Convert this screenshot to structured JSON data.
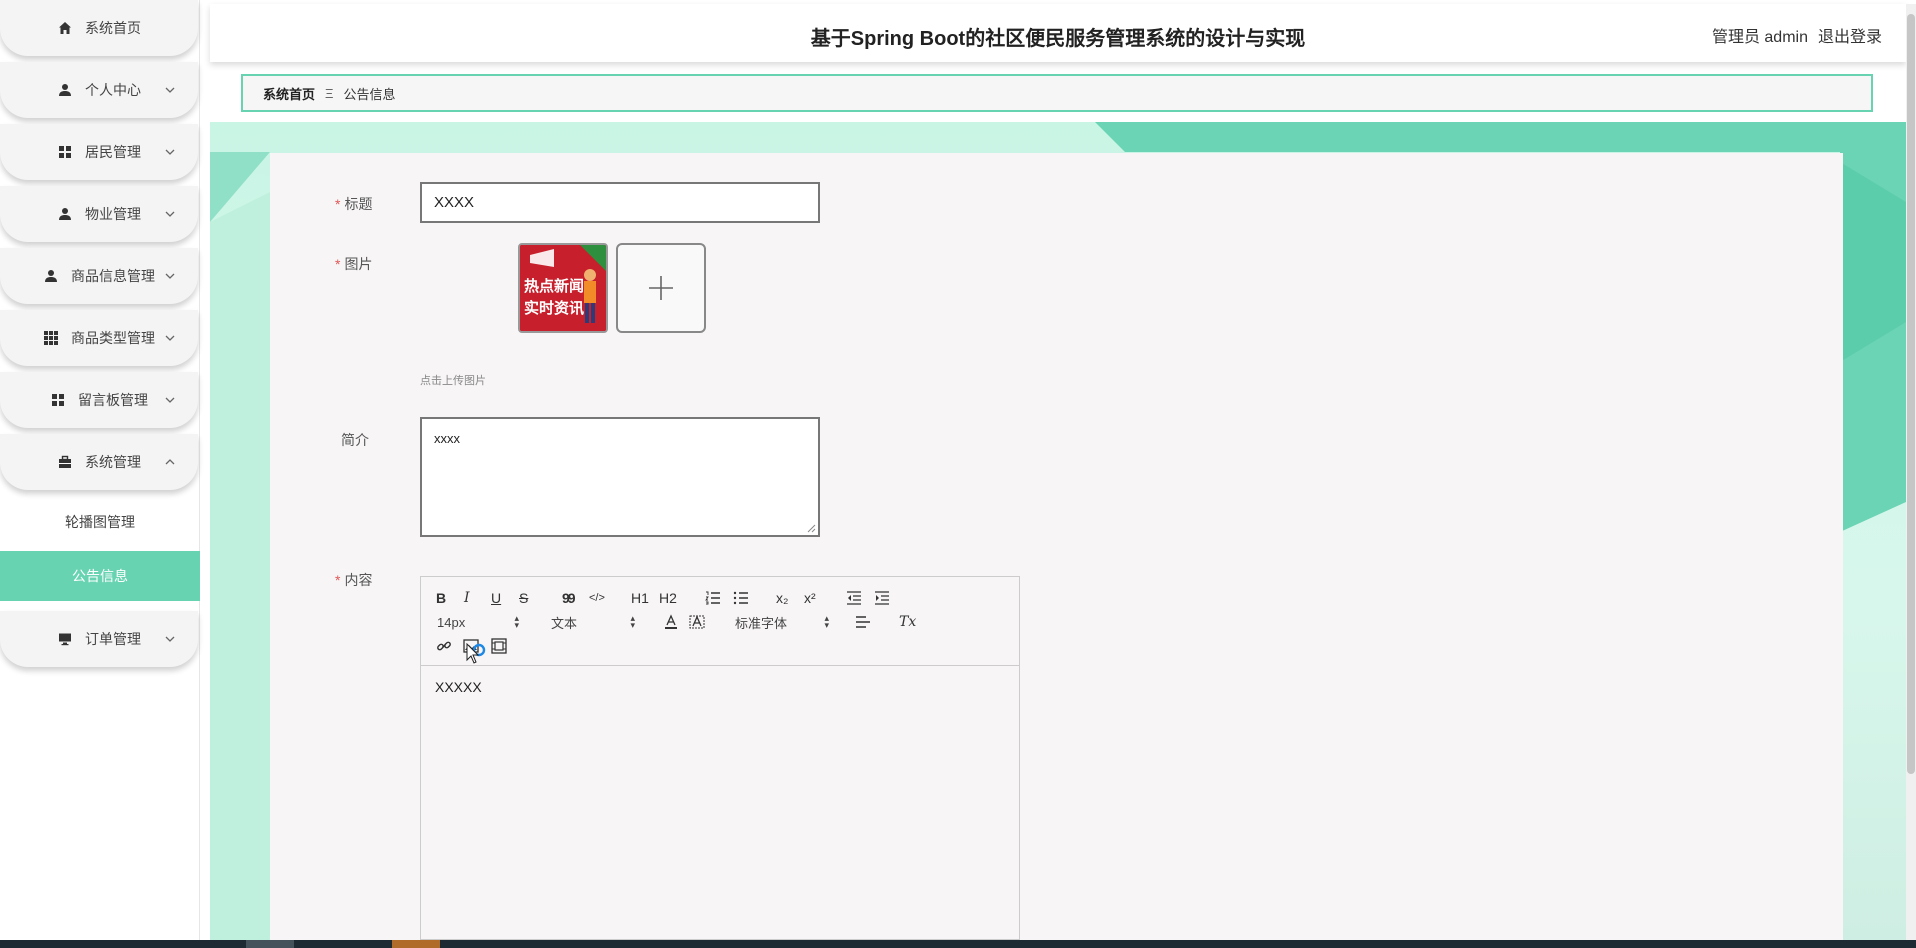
{
  "app": {
    "title": "基于Spring Boot的社区便民服务管理系统的设计与实现",
    "user_label": "管理员 admin",
    "logout_label": "退出登录"
  },
  "sidebar": {
    "items": [
      {
        "label": "系统首页",
        "icon": "home-icon"
      },
      {
        "label": "个人中心",
        "icon": "user-icon"
      },
      {
        "label": "居民管理",
        "icon": "grid-icon"
      },
      {
        "label": "物业管理",
        "icon": "user-icon"
      },
      {
        "label": "商品信息管理",
        "icon": "user-icon"
      },
      {
        "label": "商品类型管理",
        "icon": "apps-icon"
      },
      {
        "label": "留言板管理",
        "icon": "grid-icon"
      },
      {
        "label": "系统管理",
        "icon": "briefcase-icon"
      },
      {
        "label": "订单管理",
        "icon": "monitor-icon"
      }
    ],
    "sub_items": [
      "轮播图管理",
      "公告信息"
    ]
  },
  "breadcrumb": {
    "home": "系统首页",
    "separator": "Ξ",
    "current": "公告信息"
  },
  "form": {
    "title_label": "标题",
    "title_value": "XXXX",
    "image_label": "图片",
    "thumb_text_line1": "热点新闻",
    "thumb_text_line2": "实时资讯",
    "upload_hint": "点击上传图片",
    "intro_label": "简介",
    "intro_value": "xxxx",
    "content_label": "内容",
    "content_value": "XXXXX"
  },
  "editor": {
    "toolbar": {
      "bold": "B",
      "italic": "I",
      "underline": "U",
      "strike": "S",
      "quote": "99",
      "code": "</>",
      "h1": "H1",
      "h2": "H2",
      "sub": "x₂",
      "sup": "x²",
      "size": "14px",
      "style": "文本",
      "font": "标准字体",
      "clear": "Tx"
    }
  },
  "colors": {
    "accent": "#67d3b1",
    "accent_light": "#c9f5e5",
    "required": "#e05858"
  }
}
